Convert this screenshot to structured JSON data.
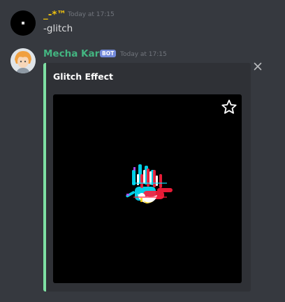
{
  "colors": {
    "background": "#36393f",
    "embed_background": "#2f3136",
    "embed_accent": "#7ee0a3",
    "bot_name": "#43b581",
    "user_name": "#f1c40f",
    "bot_badge": "#7289da",
    "timestamp": "#72767d",
    "text": "#dcddde"
  },
  "messages": [
    {
      "author": "_-*™",
      "timestamp": "Today at 17:15",
      "content": "-glitch",
      "avatar_icon": "dark-avatar-icon"
    },
    {
      "author": "Mecha Karen",
      "badge": "BOT",
      "timestamp": "Today at 17:15",
      "avatar_icon": "anime-avatar-icon",
      "embed": {
        "title": "Glitch Effect",
        "image_icon": "glitched-hand-image",
        "favorite_icon": "star-icon",
        "dismiss_icon": "close-icon"
      }
    }
  ]
}
